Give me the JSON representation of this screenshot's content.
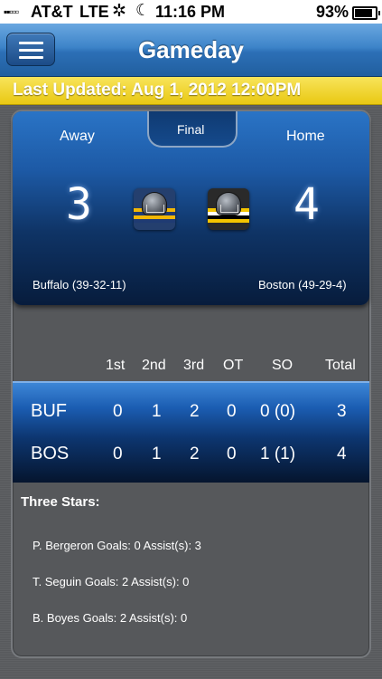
{
  "status_bar": {
    "signal": "▪▪▫▫▫",
    "carrier": "AT&T",
    "network": "LTE",
    "time": "11:16 PM",
    "battery": "93%",
    "battery_level": 0.93
  },
  "nav": {
    "title": "Gameday",
    "menu_icon": "hamburger-menu-icon"
  },
  "update_banner": {
    "text": "Last Updated: Aug 1, 2012 12:00PM"
  },
  "scoreboard": {
    "away_label": "Away",
    "home_label": "Home",
    "status": "Final",
    "away": {
      "score": "3",
      "record": "Buffalo (39-32-11)",
      "abbr": "BUF"
    },
    "home": {
      "score": "4",
      "record": "Boston  (49-29-4)",
      "abbr": "BOS"
    }
  },
  "linescore": {
    "headers": [
      "1st",
      "2nd",
      "3rd",
      "OT",
      "SO",
      "Total"
    ],
    "rows": [
      {
        "team": "BUF",
        "values": [
          "0",
          "1",
          "2",
          "0",
          "0 (0)",
          "3"
        ]
      },
      {
        "team": "BOS",
        "values": [
          "0",
          "1",
          "2",
          "0",
          "1 (1)",
          "4"
        ]
      }
    ]
  },
  "three_stars": {
    "title": "Three Stars:",
    "entries": [
      "P. Bergeron Goals: 0 Assist(s): 3",
      "T. Seguin Goals: 2 Assist(s): 0",
      "B. Boyes Goals: 2 Assist(s): 0"
    ]
  },
  "colors": {
    "nav_blue": "#3d84c9",
    "banner_yellow": "#f2d52f",
    "scoreboard_blue": "#1d5aa6",
    "background_gray": "#5a5c5f"
  }
}
